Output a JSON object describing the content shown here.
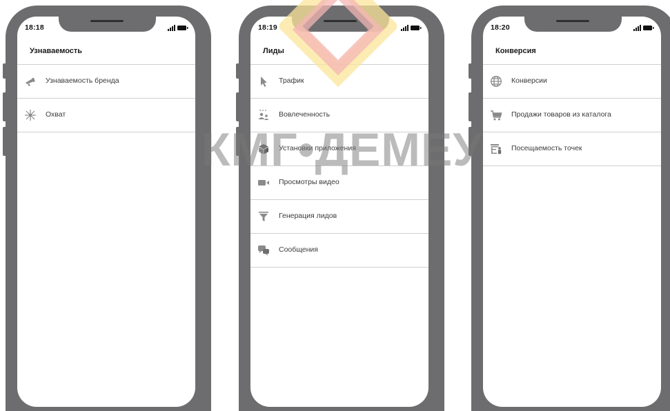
{
  "watermark": {
    "text": "КМГ•ДЕМЕУ",
    "colors": {
      "red": "#f4b6b4",
      "yellow": "#fbe59a"
    }
  },
  "colors": {
    "frame": "#6d6d6f",
    "divider": "#cfcfcf",
    "icon": "#8a8a8a",
    "text": "#3a3a3a"
  },
  "phones": [
    {
      "time": "18:18",
      "title": "Узнаваемость",
      "items": [
        {
          "label": "Узнаваемость бренда",
          "icon": "megaphone-icon"
        },
        {
          "label": "Охват",
          "icon": "reach-icon"
        }
      ]
    },
    {
      "time": "18:19",
      "title": "Лиды",
      "items": [
        {
          "label": "Трафик",
          "icon": "cursor-icon"
        },
        {
          "label": "Вовлеченность",
          "icon": "people-icon"
        },
        {
          "label": "Установки приложения",
          "icon": "box-icon"
        },
        {
          "label": "Просмотры видео",
          "icon": "video-icon"
        },
        {
          "label": "Генерация лидов",
          "icon": "funnel-icon"
        },
        {
          "label": "Сообщения",
          "icon": "chat-icon"
        }
      ]
    },
    {
      "time": "18:20",
      "title": "Конверсия",
      "items": [
        {
          "label": "Конверсии",
          "icon": "globe-icon"
        },
        {
          "label": "Продажи товаров из каталога",
          "icon": "cart-icon"
        },
        {
          "label": "Посещаемость точек",
          "icon": "store-icon"
        }
      ]
    }
  ]
}
